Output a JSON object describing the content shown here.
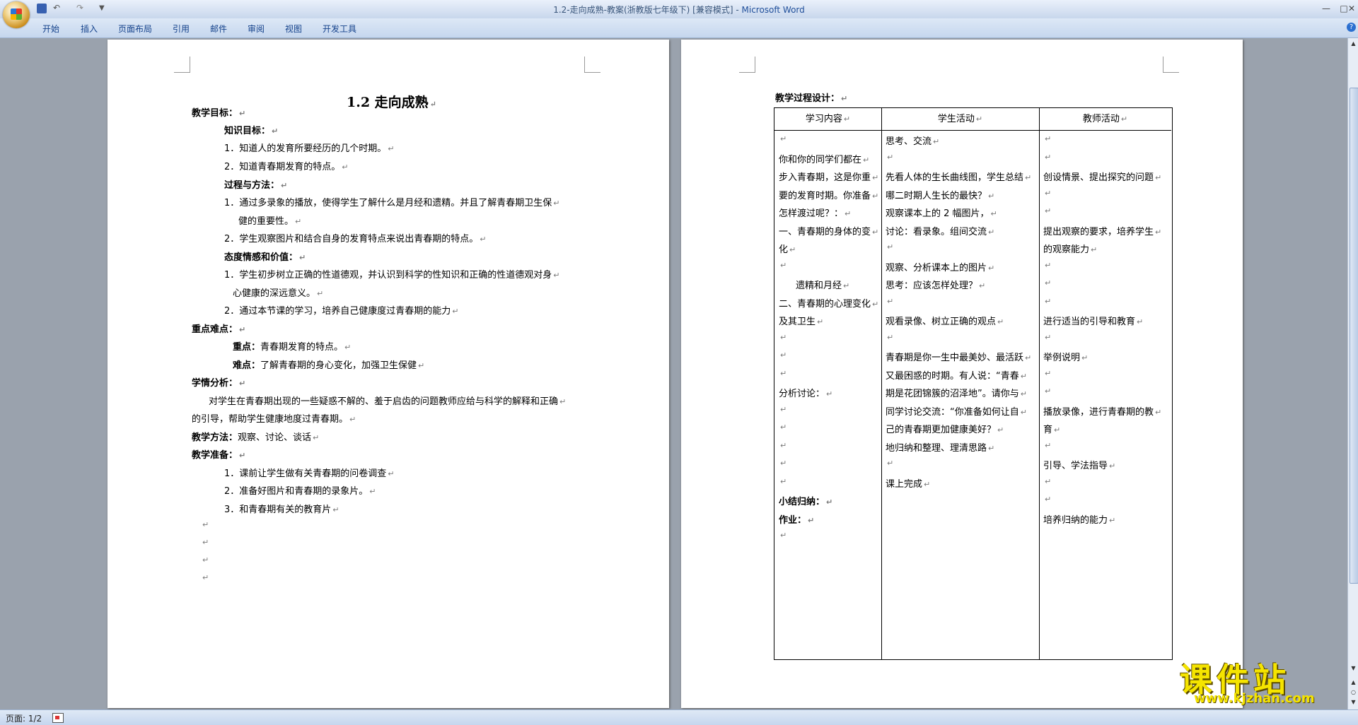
{
  "window": {
    "title": "1.2-走向成熟-教案(浙教版七年级下) [兼容模式]",
    "app_name": "Microsoft Word",
    "window_buttons": {
      "minimize": "—",
      "maximize": "□",
      "close": "✕"
    }
  },
  "quick_access": {
    "undo": "↶",
    "redo": "↷",
    "more": "▼"
  },
  "ribbon": {
    "tabs": [
      "开始",
      "插入",
      "页面布局",
      "引用",
      "邮件",
      "审阅",
      "视图",
      "开发工具"
    ],
    "help": "?"
  },
  "page1": {
    "title": "1.2 走向成熟",
    "lines": [
      {
        "text": "教学目标：",
        "bold": true
      },
      {
        "text": "知识目标：",
        "bold": true
      },
      {
        "text": "1．知道人的发育所要经历的几个时期。",
        "bold": false
      },
      {
        "text": "2．知道青春期发育的特点。",
        "bold": false
      },
      {
        "text": "过程与方法：",
        "bold": true
      },
      {
        "text": "1．通过多录象的播放，使得学生了解什么是月经和遗精。并且了解青春期卫生保",
        "bold": false
      },
      {
        "text": "健的重要性。",
        "bold": false
      },
      {
        "text": "2．学生观察图片和结合自身的发育特点来说出青春期的特点。",
        "bold": false
      },
      {
        "text": "态度情感和价值：",
        "bold": true
      },
      {
        "text": "1．学生初步树立正确的性道德观，并认识到科学的性知识和正确的性道德观对身",
        "bold": false
      },
      {
        "text": "心健康的深远意义。",
        "bold": false
      },
      {
        "text": "2．通过本节课的学习，培养自己健康度过青春期的能力",
        "bold": false
      },
      {
        "text": "重点难点：",
        "bold": true
      },
      {
        "label": "重点：",
        "text": "青春期发育的特点。"
      },
      {
        "label": "难点：",
        "text": "了解青春期的身心变化，加强卫生保健"
      },
      {
        "text": "学情分析：",
        "bold": true
      },
      {
        "text": "对学生在青春期出现的一些疑惑不解的、羞于启齿的问题教师应给与科学的解释和正确",
        "bold": false
      },
      {
        "text": "的引导，帮助学生健康地度过青春期。",
        "bold": false
      },
      {
        "label": "教学方法：",
        "text": "观察、讨论、谈话"
      },
      {
        "text": "教学准备：",
        "bold": true
      },
      {
        "text": "1．课前让学生做有关青春期的问卷调查",
        "bold": false
      },
      {
        "text": "2．准备好图片和青春期的录象片。",
        "bold": false
      },
      {
        "text": "3．和青春期有关的教育片",
        "bold": false
      }
    ]
  },
  "page2": {
    "heading": "教学过程设计：",
    "table": {
      "headers": [
        "学习内容",
        "学生活动",
        "教师活动"
      ],
      "col1": [
        "",
        "你和你的同学们都在",
        "步入青春期，这是你重",
        "要的发育时期。你准备",
        "怎样渡过呢？：",
        "一、青春期的身体的变",
        "化",
        "",
        "遗精和月经",
        "二、青春期的心理变化",
        "及其卫生",
        "",
        "",
        "",
        "分析讨论：",
        "",
        "",
        "",
        "",
        "",
        "小结归纳：",
        "作业：",
        ""
      ],
      "col2": [
        "思考、交流",
        "",
        "先看人体的生长曲线图，学生总结",
        "哪二时期人生长的最快？",
        "观察课本上的 2 幅图片，",
        "讨论：看录象。组间交流",
        "",
        "观察、分析课本上的图片",
        "思考：应该怎样处理？",
        "",
        "观看录像、树立正确的观点",
        "",
        "青春期是你一生中最美妙、最活跃",
        "又最困惑的时期。有人说：“青春",
        "期是花团锦簇的沼泽地”。请你与",
        "同学讨论交流：“你准备如何让自",
        "己的青春期更加健康美好？",
        "地归纳和整理、理清思路",
        "",
        "课上完成"
      ],
      "col3": [
        "",
        "",
        "创设情景、提出探究的问题",
        "",
        "",
        "提出观察的要求，培养学生",
        "的观察能力",
        "",
        "",
        "",
        "进行适当的引导和教育",
        "",
        "举例说明",
        "",
        "",
        "播放录像，进行青春期的教",
        "育",
        "",
        "引导、学法指导",
        "",
        "",
        "培养归纳的能力"
      ]
    }
  },
  "status": {
    "page_count": "页面: 1/2"
  },
  "watermark": {
    "text": "课件站",
    "url": "www.kjzhan.com"
  }
}
